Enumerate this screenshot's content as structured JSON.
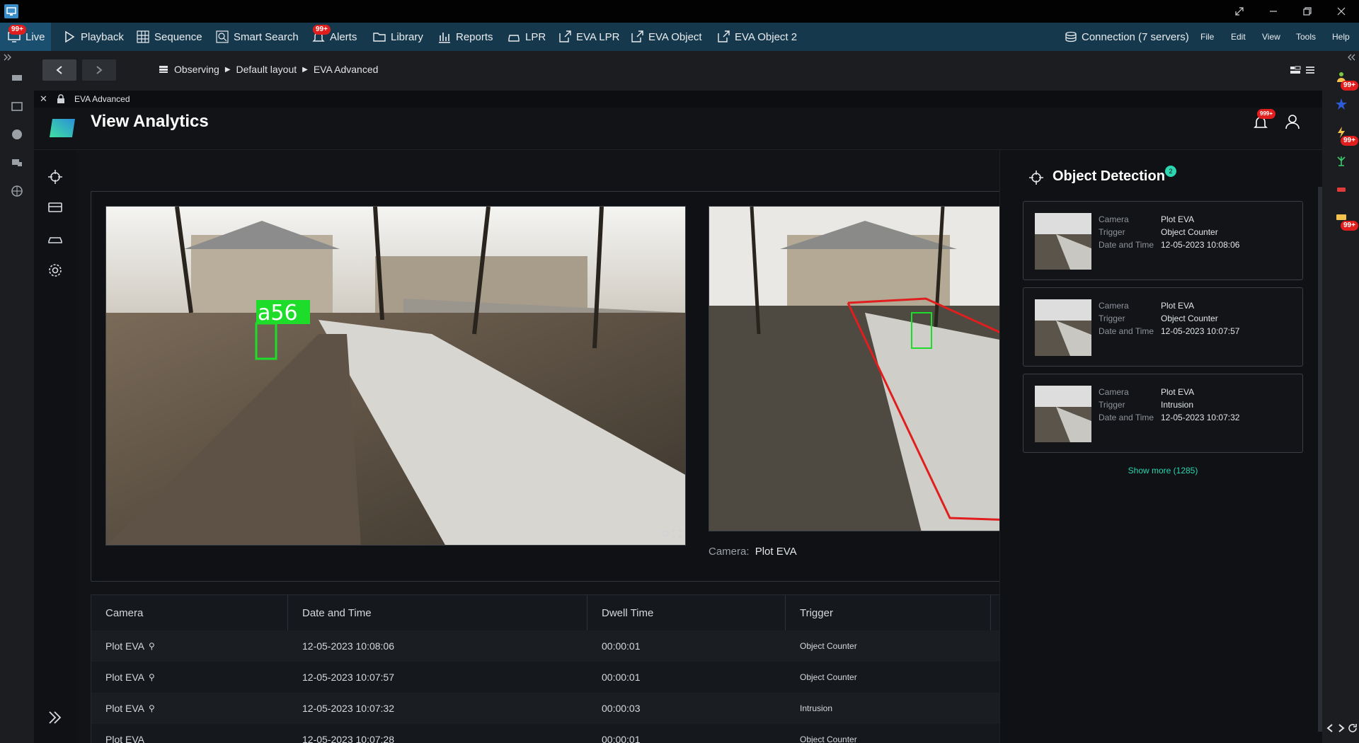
{
  "menubar": {
    "tabs": [
      {
        "label": "Live",
        "icon": "monitor-icon",
        "badge": "99+"
      },
      {
        "label": "Playback",
        "icon": "play-icon"
      },
      {
        "label": "Sequence",
        "icon": "grid-icon"
      },
      {
        "label": "Smart Search",
        "icon": "smart-search-icon"
      },
      {
        "label": "Alerts",
        "icon": "bell-icon",
        "badge": "99+"
      },
      {
        "label": "Library",
        "icon": "folder-icon"
      },
      {
        "label": "Reports",
        "icon": "bar-chart-icon"
      },
      {
        "label": "LPR",
        "icon": "car-icon"
      },
      {
        "label": "EVA LPR",
        "icon": "external-link-icon"
      },
      {
        "label": "EVA Object",
        "icon": "external-link-icon"
      },
      {
        "label": "EVA Object 2",
        "icon": "external-link-icon"
      }
    ],
    "connection": "Connection (7 servers)",
    "menus": [
      "File",
      "Edit",
      "View",
      "Tools",
      "Help"
    ]
  },
  "breadcrumb": [
    "Observing",
    "Default layout",
    "EVA Advanced"
  ],
  "tab": {
    "label": "EVA Advanced"
  },
  "header": {
    "title": "View Analytics",
    "notif_badge": "999+"
  },
  "video": {
    "overlay_label": "a56",
    "camera_label": "Camera:",
    "camera_name": "Plot EVA"
  },
  "table": {
    "headers": [
      "Camera",
      "Date and Time",
      "Dwell Time",
      "Trigger"
    ],
    "rows": [
      {
        "camera": "Plot EVA",
        "datetime": "12-05-2023 10:08:06",
        "dwell": "00:00:01",
        "trigger": "Object Counter"
      },
      {
        "camera": "Plot EVA",
        "datetime": "12-05-2023 10:07:57",
        "dwell": "00:00:01",
        "trigger": "Object Counter"
      },
      {
        "camera": "Plot EVA",
        "datetime": "12-05-2023 10:07:32",
        "dwell": "00:00:03",
        "trigger": "Intrusion"
      },
      {
        "camera": "Plot EVA",
        "datetime": "12-05-2023 10:07:28",
        "dwell": "00:00:01",
        "trigger": "Object Counter"
      }
    ]
  },
  "object_detection": {
    "title": "Object Detection",
    "count_badge": "2",
    "labels": {
      "camera": "Camera",
      "trigger": "Trigger",
      "datetime": "Date and Time"
    },
    "cards": [
      {
        "camera": "Plot EVA",
        "trigger": "Object Counter",
        "datetime": "12-05-2023 10:08:06"
      },
      {
        "camera": "Plot EVA",
        "trigger": "Object Counter",
        "datetime": "12-05-2023 10:07:57"
      },
      {
        "camera": "Plot EVA",
        "trigger": "Intrusion",
        "datetime": "12-05-2023 10:07:32"
      }
    ],
    "show_more": "Show more (1285)"
  },
  "right_rail_badges": [
    "99+",
    "99+",
    "99+"
  ],
  "colors": {
    "accent": "#2bd6b0",
    "menubar": "#16384c",
    "badge": "#e01e1e"
  }
}
